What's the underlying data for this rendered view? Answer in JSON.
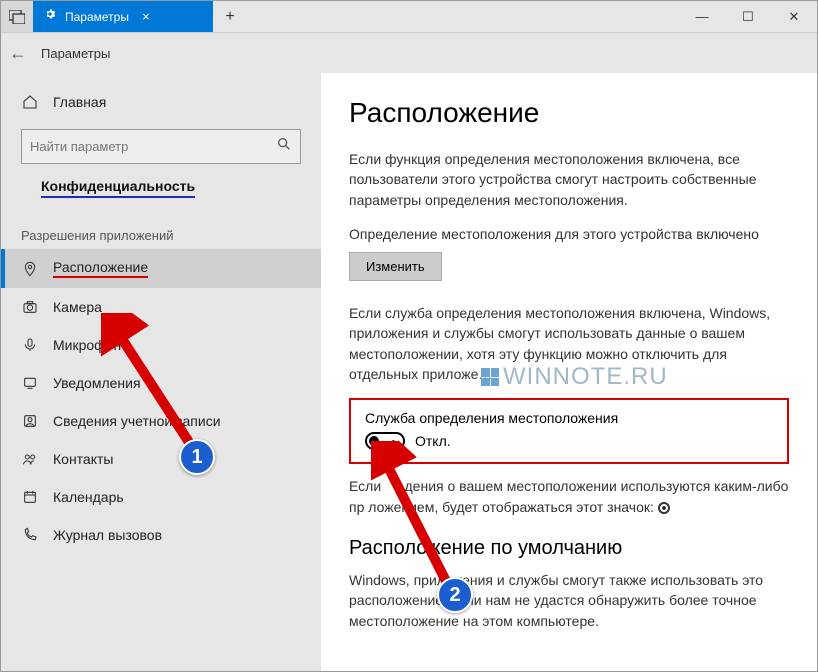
{
  "titlebar": {
    "tab_title": "Параметры",
    "close_tab": "×",
    "new_tab": "+",
    "minimize": "—",
    "maximize": "☐",
    "close": "✕"
  },
  "breadcrumb": {
    "back": "←",
    "text": "Параметры"
  },
  "sidebar": {
    "home": "Главная",
    "search_placeholder": "Найти параметр",
    "section": "Конфиденциальность",
    "group_label": "Разрешения приложений",
    "items": [
      {
        "label": "Расположение",
        "icon": "location"
      },
      {
        "label": "Камера",
        "icon": "camera"
      },
      {
        "label": "Микрофон",
        "icon": "microphone"
      },
      {
        "label": "Уведомления",
        "icon": "notifications"
      },
      {
        "label": "Сведения учетной записи",
        "icon": "account"
      },
      {
        "label": "Контакты",
        "icon": "contacts"
      },
      {
        "label": "Календарь",
        "icon": "calendar"
      },
      {
        "label": "Журнал вызовов",
        "icon": "callhistory"
      }
    ]
  },
  "content": {
    "heading": "Расположение",
    "p1": "Если функция определения местоположения включена, все пользователи этого устройства смогут настроить собственные параметры определения местоположения.",
    "status_line": "Определение местоположения для этого устройства включено",
    "change_btn": "Изменить",
    "p2": "Если служба определения местоположения включена, Windows, приложения и службы смогут использовать данные о вашем местоположении, хотя эту функцию можно отключить для отдельных приложе…",
    "toggle_label": "Служба определения местоположения",
    "toggle_state": "Откл.",
    "p3_a": "Если",
    "p3_b": "дения о вашем местоположении используются каким-либо пр",
    "p3_c": "ложением, будет отображаться этот значок:",
    "h2": "Расположение по умолчанию",
    "p4": "Windows, приложения и службы смогут также использовать это расположение, если нам не удастся обнаружить более точное местоположение на этом компьютере."
  },
  "watermark": {
    "text": "WINNOTE.RU"
  },
  "annotations": {
    "badge1": "1",
    "badge2": "2"
  }
}
